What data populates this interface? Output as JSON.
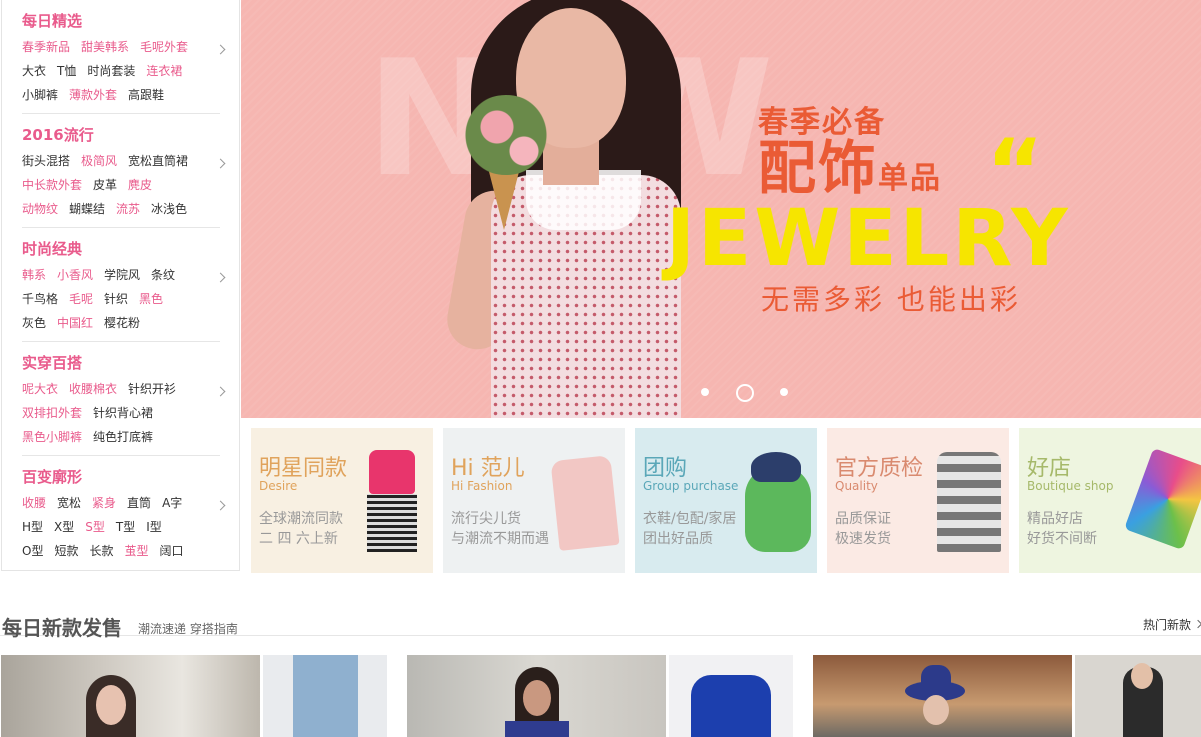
{
  "sidebar": {
    "categories": [
      {
        "title": "每日精选",
        "rows": [
          [
            {
              "t": "春季新品",
              "c": "pink"
            },
            {
              "t": "甜美韩系",
              "c": "pink"
            },
            {
              "t": "毛呢外套",
              "c": "pink"
            }
          ],
          [
            {
              "t": "大衣",
              "c": "dark"
            },
            {
              "t": "T恤",
              "c": "dark"
            },
            {
              "t": "时尚套装",
              "c": "dark"
            },
            {
              "t": "连衣裙",
              "c": "pink"
            }
          ],
          [
            {
              "t": "小脚裤",
              "c": "dark"
            },
            {
              "t": "薄款外套",
              "c": "pink"
            },
            {
              "t": "高跟鞋",
              "c": "dark"
            }
          ]
        ]
      },
      {
        "title": "2016流行",
        "rows": [
          [
            {
              "t": "街头混搭",
              "c": "dark"
            },
            {
              "t": "极简风",
              "c": "pink"
            },
            {
              "t": "宽松直筒裙",
              "c": "dark"
            }
          ],
          [
            {
              "t": "中长款外套",
              "c": "pink"
            },
            {
              "t": "皮革",
              "c": "dark"
            },
            {
              "t": "麂皮",
              "c": "pink"
            }
          ],
          [
            {
              "t": "动物纹",
              "c": "pink"
            },
            {
              "t": "蝴蝶结",
              "c": "dark"
            },
            {
              "t": "流苏",
              "c": "pink"
            },
            {
              "t": "冰浅色",
              "c": "dark"
            }
          ]
        ]
      },
      {
        "title": "时尚经典",
        "rows": [
          [
            {
              "t": "韩系",
              "c": "pink"
            },
            {
              "t": "小香风",
              "c": "pink"
            },
            {
              "t": "学院风",
              "c": "dark"
            },
            {
              "t": "条纹",
              "c": "dark"
            }
          ],
          [
            {
              "t": "千鸟格",
              "c": "dark"
            },
            {
              "t": "毛呢",
              "c": "pink"
            },
            {
              "t": "针织",
              "c": "dark"
            },
            {
              "t": "黑色",
              "c": "pink"
            }
          ],
          [
            {
              "t": "灰色",
              "c": "dark"
            },
            {
              "t": "中国红",
              "c": "pink"
            },
            {
              "t": "樱花粉",
              "c": "dark"
            }
          ]
        ]
      },
      {
        "title": "实穿百搭",
        "rows": [
          [
            {
              "t": "呢大衣",
              "c": "pink"
            },
            {
              "t": "收腰棉衣",
              "c": "pink"
            },
            {
              "t": "针织开衫",
              "c": "dark"
            }
          ],
          [
            {
              "t": "双排扣外套",
              "c": "pink"
            },
            {
              "t": "针织背心裙",
              "c": "dark"
            }
          ],
          [
            {
              "t": "黑色小脚裤",
              "c": "pink"
            },
            {
              "t": "纯色打底裤",
              "c": "dark"
            }
          ]
        ]
      },
      {
        "title": "百变廓形",
        "rows": [
          [
            {
              "t": "收腰",
              "c": "pink"
            },
            {
              "t": "宽松",
              "c": "dark"
            },
            {
              "t": "紧身",
              "c": "pink"
            },
            {
              "t": "直筒",
              "c": "dark"
            },
            {
              "t": "A字",
              "c": "dark"
            }
          ],
          [
            {
              "t": "H型",
              "c": "dark"
            },
            {
              "t": "X型",
              "c": "dark"
            },
            {
              "t": "S型",
              "c": "pink"
            },
            {
              "t": "T型",
              "c": "dark"
            },
            {
              "t": "I型",
              "c": "dark"
            }
          ],
          [
            {
              "t": "O型",
              "c": "dark"
            },
            {
              "t": "短款",
              "c": "dark"
            },
            {
              "t": "长款",
              "c": "dark"
            },
            {
              "t": "茧型",
              "c": "pink"
            },
            {
              "t": "阔口",
              "c": "dark"
            }
          ]
        ]
      }
    ]
  },
  "banner": {
    "line1": "春季必备",
    "line2_big": "配饰",
    "line2_small": "单品",
    "quote": "“",
    "line3": "JEWELRY",
    "line4": "无需多彩 也能出彩",
    "ghost": "NEW",
    "slide_count": 3,
    "active_slide": 2
  },
  "tiles": [
    {
      "title": "明星同款",
      "sub": "Desire",
      "d1": "全球潮流同款",
      "d2": "二 四 六上新",
      "bg": "#f8f0e2",
      "color": "#e0a35c",
      "img": "dress-icon"
    },
    {
      "title": "Hi 范儿",
      "sub": "Hi Fashion",
      "d1": "流行尖儿货",
      "d2": "与潮流不期而遇",
      "bg": "#eef1f2",
      "color": "#e0a35c",
      "img": "sweater-icon"
    },
    {
      "title": "团购",
      "sub": "Group purchase",
      "d1": "衣鞋/包配/家居",
      "d2": "团出好品质",
      "bg": "#d8ebef",
      "color": "#5aa7b8",
      "img": "backpack-icon"
    },
    {
      "title": "官方质检",
      "sub": "Quality",
      "d1": "品质保证",
      "d2": "极速发货",
      "bg": "#fbeae4",
      "color": "#d98a6f",
      "img": "striped-sweater-icon"
    },
    {
      "title": "好店",
      "sub": "Boutique shop",
      "d1": "精品好店",
      "d2": "好货不间断",
      "bg": "#eef5e0",
      "color": "#a6b96a",
      "img": "bag-icon"
    }
  ],
  "section": {
    "title": "每日新款发售",
    "subtitle": "潮流速递 穿搭指南",
    "more": "热门新款"
  }
}
